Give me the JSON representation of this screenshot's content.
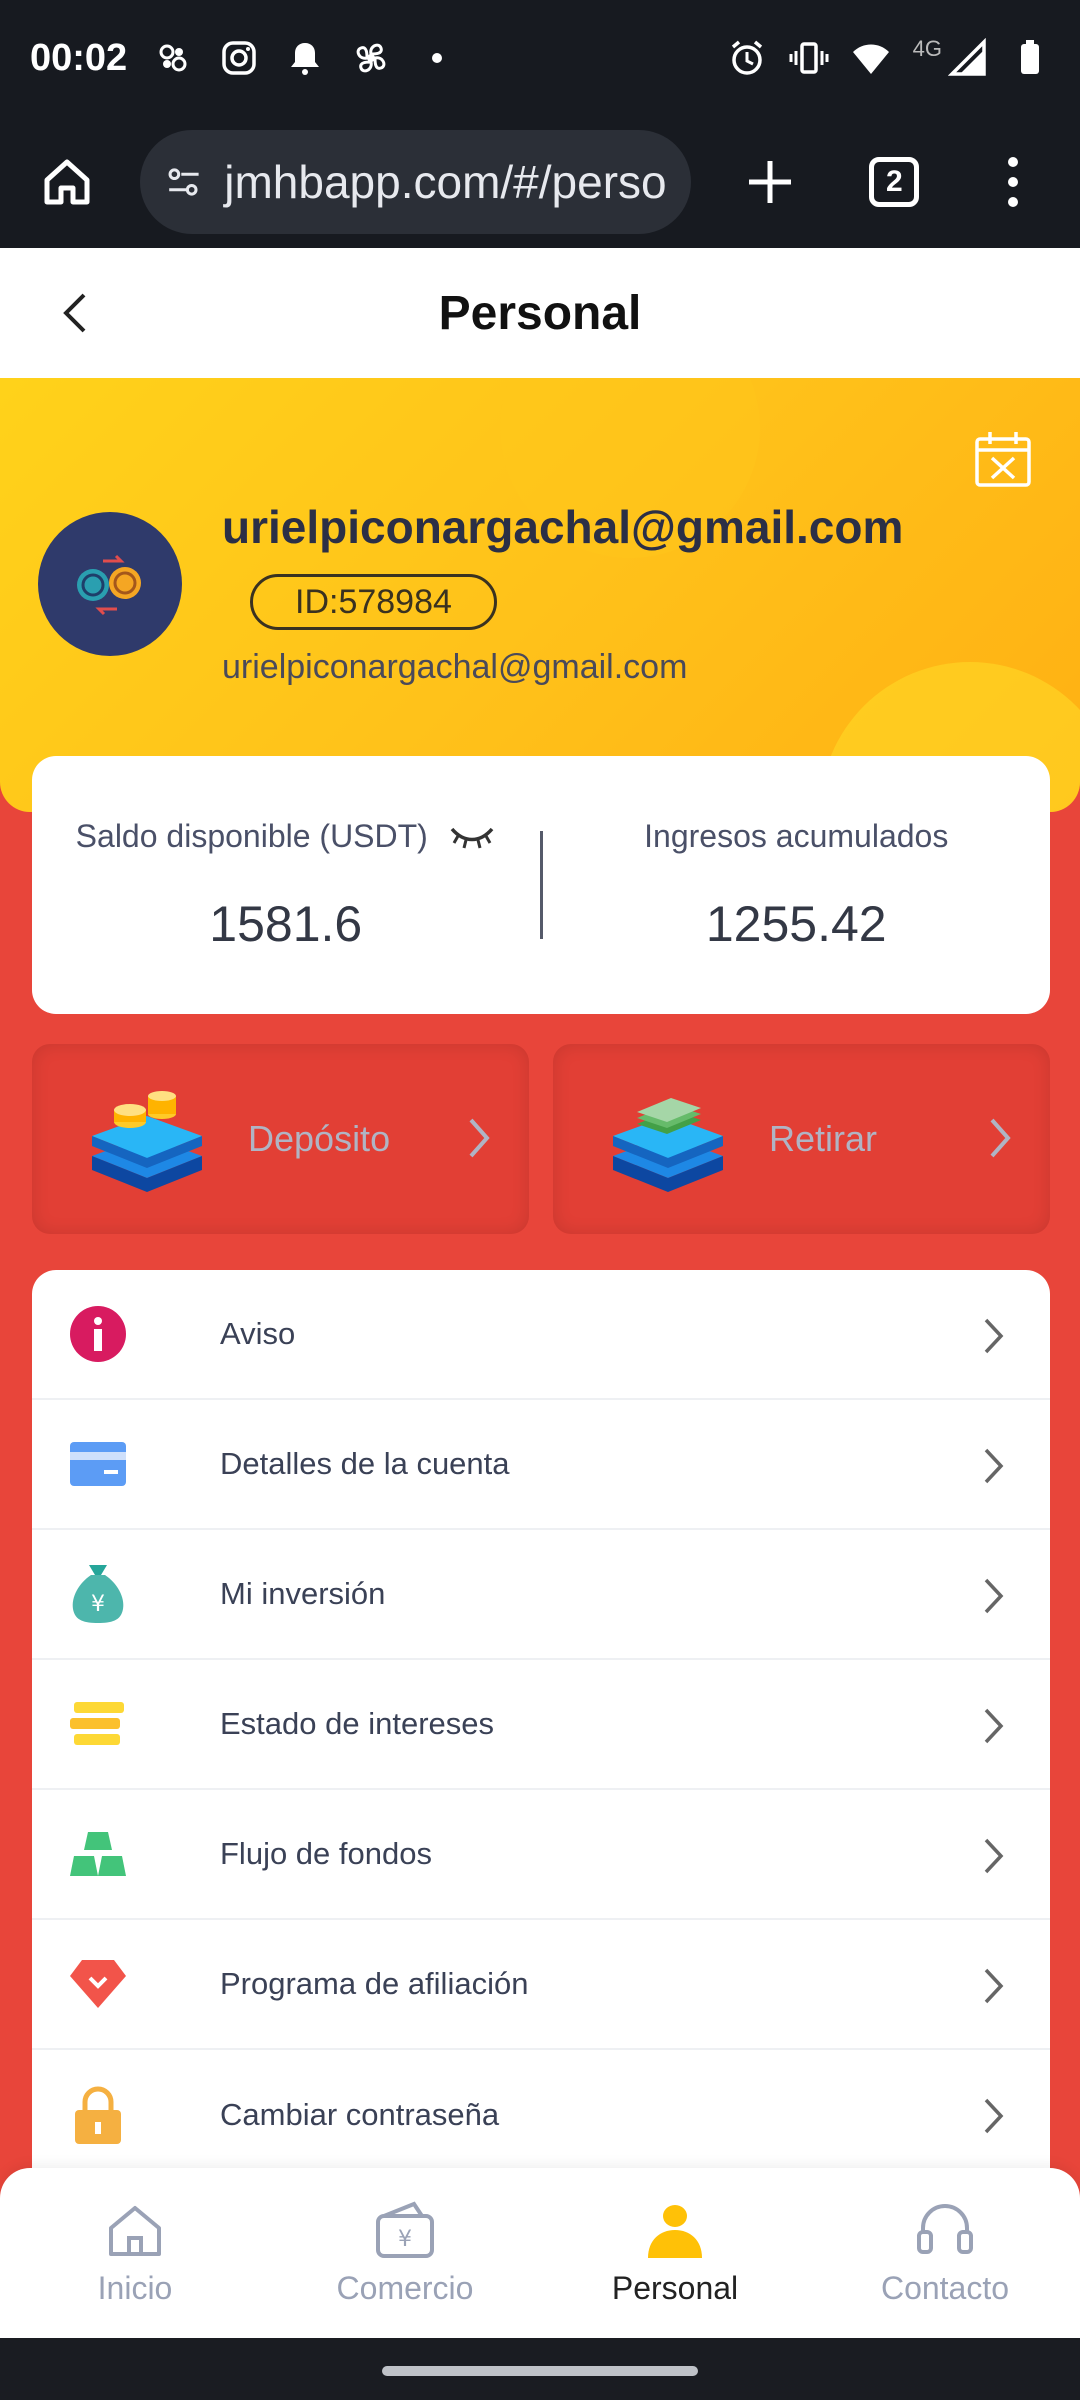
{
  "status_bar": {
    "time": "00:02",
    "network": "4G"
  },
  "browser": {
    "url": "jmhbapp.com/#/perso",
    "tab_count": "2"
  },
  "header": {
    "title": "Personal"
  },
  "profile": {
    "name": "urielpiconargachal@gmail.com",
    "id": "ID:578984",
    "email": "urielpiconargachal@gmail.com"
  },
  "balance": {
    "available_label": "Saldo disponible (USDT)",
    "available_value": "1581.6",
    "income_label": "Ingresos acumulados",
    "income_value": "1255.42"
  },
  "actions": {
    "deposit_label": "Depósito",
    "withdraw_label": "Retirar"
  },
  "menu": {
    "items": [
      {
        "label": "Aviso",
        "icon": "info-icon"
      },
      {
        "label": "Detalles de la cuenta",
        "icon": "card-icon"
      },
      {
        "label": "Mi inversión",
        "icon": "money-bag-icon"
      },
      {
        "label": "Estado de intereses",
        "icon": "stack-icon"
      },
      {
        "label": "Flujo de fondos",
        "icon": "gold-bars-icon"
      },
      {
        "label": "Programa de afiliación",
        "icon": "diamond-icon"
      },
      {
        "label": "Cambiar contraseña",
        "icon": "lock-icon"
      }
    ]
  },
  "nav": {
    "items": [
      {
        "label": "Inicio",
        "icon": "home-icon"
      },
      {
        "label": "Comercio",
        "icon": "wallet-icon"
      },
      {
        "label": "Personal",
        "icon": "person-icon"
      },
      {
        "label": "Contacto",
        "icon": "headset-icon"
      }
    ],
    "active": "Personal"
  },
  "colors": {
    "primary_red": "#e8453a",
    "banner_yellow": "#ffc21a",
    "text_dark": "#2b2f46"
  }
}
